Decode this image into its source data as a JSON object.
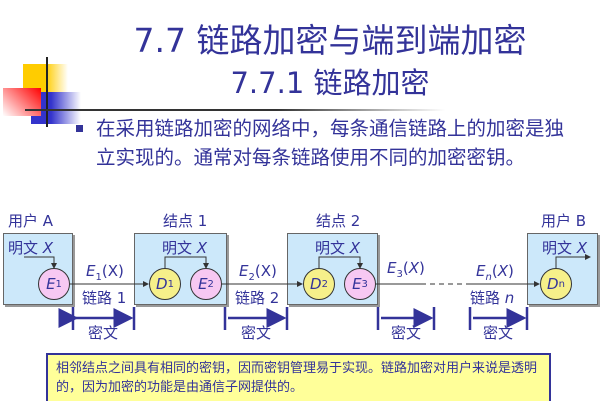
{
  "slide": {
    "title": "7.7  链路加密与端到端加密",
    "subtitle": "7.7.1 链路加密",
    "bullet": "在采用链路加密的网络中，每条通信链路上的加密是独立实现的。通常对每条链路使用不同的加密密钥。"
  },
  "diagram": {
    "user_a": "用户 A",
    "node1": "结点 1",
    "node2": "结点 2",
    "user_b": "用户 B",
    "plaintext": "明文",
    "x": "X",
    "E": "E",
    "D": "D",
    "sub1": "1",
    "sub2": "2",
    "sub3": "3",
    "subn": "n",
    "link1": "链路 1",
    "link2": "链路 2",
    "linkn_prefix": "链路",
    "linkn_suffix": "n",
    "e1x": {
      "a": "E",
      "s": "1",
      "b": "(X)"
    },
    "e2x": {
      "a": "E",
      "s": "2",
      "b": "(X)"
    },
    "e3x": {
      "a": "E",
      "s": "3",
      "b": "(",
      "c": "X",
      "d": ")"
    },
    "enx": {
      "a": "E",
      "s": "n",
      "b": "(",
      "c": "X",
      "d": ")"
    },
    "ciphertext": "密文"
  },
  "note": "相邻结点之间具有相同的密钥，因而密钥管理易于实现。链路加密对用户来说是透明的，因为加密的功能是由通信子网提供的。",
  "colors": {
    "text": "#333399",
    "box": "#cce8fa",
    "pink": "#f7c8f2",
    "yellow": "#f6f08a",
    "note": "#ffff99"
  }
}
